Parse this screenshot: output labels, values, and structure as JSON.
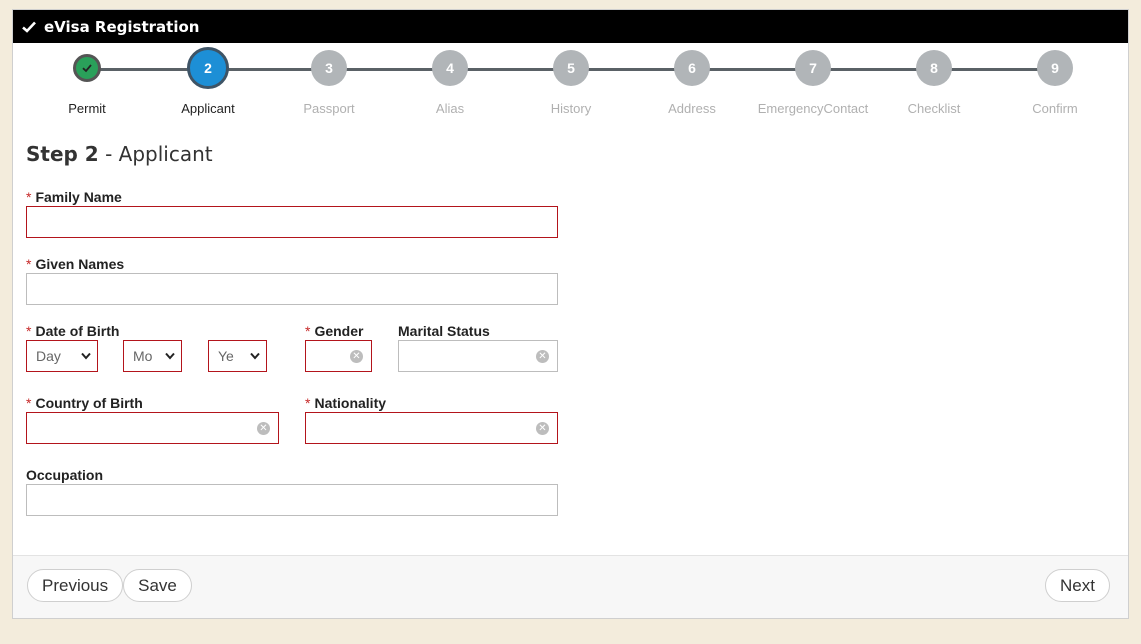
{
  "titlebar": {
    "title": "eVisa Registration",
    "icon": "check-icon"
  },
  "stepper": {
    "steps": [
      {
        "number": "",
        "label": "Permit",
        "state": "done"
      },
      {
        "number": "2",
        "label": "Applicant",
        "state": "active"
      },
      {
        "number": "3",
        "label": "Passport",
        "state": "pending"
      },
      {
        "number": "4",
        "label": "Alias",
        "state": "pending"
      },
      {
        "number": "5",
        "label": "History",
        "state": "pending"
      },
      {
        "number": "6",
        "label": "Address",
        "state": "pending"
      },
      {
        "number": "7",
        "label": "EmergencyContact",
        "state": "pending"
      },
      {
        "number": "8",
        "label": "Checklist",
        "state": "pending"
      },
      {
        "number": "9",
        "label": "Confirm",
        "state": "pending"
      }
    ]
  },
  "heading": {
    "step": "Step 2",
    "title": "- Applicant"
  },
  "form": {
    "required_marker": "*",
    "family_name": {
      "label": "Family Name",
      "value": ""
    },
    "given_names": {
      "label": "Given Names",
      "value": ""
    },
    "date_of_birth": {
      "label": "Date of Birth",
      "day": "Day",
      "month": "Mo",
      "year": "Ye"
    },
    "gender": {
      "label": "Gender",
      "value": ""
    },
    "marital_status": {
      "label": "Marital Status",
      "value": ""
    },
    "country_of_birth": {
      "label": "Country of Birth",
      "value": ""
    },
    "nationality": {
      "label": "Nationality",
      "value": ""
    },
    "occupation": {
      "label": "Occupation",
      "value": ""
    }
  },
  "footer": {
    "previous": "Previous",
    "save": "Save",
    "next": "Next"
  },
  "colors": {
    "error_border": "#b3141b",
    "active_step": "#1d8fd6",
    "done_step": "#2aa05a",
    "pending_step": "#b1b5b8"
  }
}
